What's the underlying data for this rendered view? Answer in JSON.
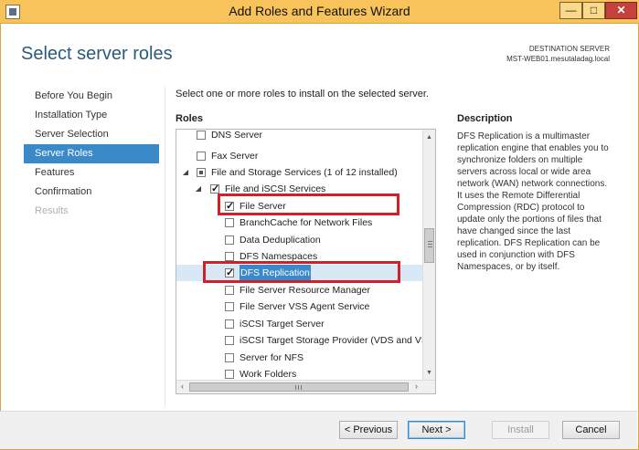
{
  "window": {
    "title": "Add Roles and Features Wizard",
    "minimize_glyph": "—",
    "maximize_glyph": "□",
    "close_glyph": "✕"
  },
  "header": {
    "page_title": "Select server roles",
    "destination_label": "DESTINATION SERVER",
    "destination_server": "MST-WEB01.mesutaladag.local"
  },
  "nav": {
    "items": [
      {
        "label": "Before You Begin",
        "state": "normal"
      },
      {
        "label": "Installation Type",
        "state": "normal"
      },
      {
        "label": "Server Selection",
        "state": "normal"
      },
      {
        "label": "Server Roles",
        "state": "active"
      },
      {
        "label": "Features",
        "state": "normal"
      },
      {
        "label": "Confirmation",
        "state": "normal"
      },
      {
        "label": "Results",
        "state": "disabled"
      }
    ]
  },
  "main": {
    "instruction": "Select one or more roles to install on the selected server.",
    "roles_label": "Roles",
    "roles": [
      {
        "label": "DNS Server",
        "checked": false
      },
      {
        "label": "Fax Server",
        "checked": false
      },
      {
        "label": "File and Storage Services (1 of 12 installed)",
        "checked": "partial",
        "expander": "◢"
      },
      {
        "label": "File and iSCSI Services",
        "checked": true,
        "expander": "◢"
      },
      {
        "label": "File Server",
        "checked": true
      },
      {
        "label": "BranchCache for Network Files",
        "checked": false
      },
      {
        "label": "Data Deduplication",
        "checked": false
      },
      {
        "label": "DFS Namespaces",
        "checked": false
      },
      {
        "label": "DFS Replication",
        "checked": true
      },
      {
        "label": "File Server Resource Manager",
        "checked": false
      },
      {
        "label": "File Server VSS Agent Service",
        "checked": false
      },
      {
        "label": "iSCSI Target Server",
        "checked": false
      },
      {
        "label": "iSCSI Target Storage Provider (VDS and VSS",
        "checked": false
      },
      {
        "label": "Server for NFS",
        "checked": false
      },
      {
        "label": "Work Folders",
        "checked": false
      }
    ],
    "scroll": {
      "up_glyph": "▲",
      "down_glyph": "▼",
      "left_glyph": "‹",
      "right_glyph": "›"
    }
  },
  "description": {
    "label": "Description",
    "text": "DFS Replication is a multimaster replication engine that enables you to synchronize folders on multiple servers across local or wide area network (WAN) network connections. It uses the Remote Differential Compression (RDC) protocol to update only the portions of files that have changed since the last replication. DFS Replication can be used in conjunction with DFS Namespaces, or by itself."
  },
  "footer": {
    "previous_label": "< Previous",
    "next_label": "Next >",
    "install_label": "Install",
    "cancel_label": "Cancel"
  },
  "colors": {
    "titlebar": "#f7c35a",
    "accent": "#3a89c9",
    "highlight_box": "#d0202a",
    "page_title": "#2a5b7a"
  }
}
